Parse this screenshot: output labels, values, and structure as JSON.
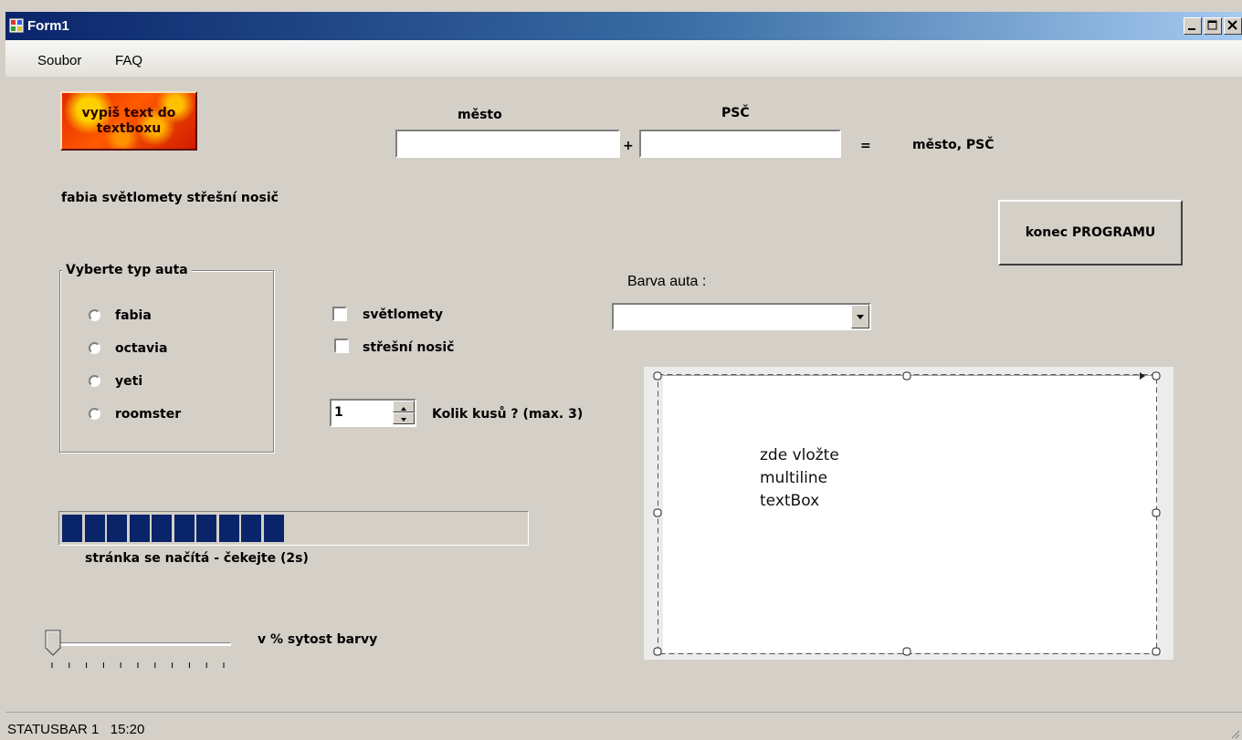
{
  "window": {
    "title": "Form1"
  },
  "menu": {
    "items": [
      "Soubor",
      "FAQ"
    ]
  },
  "fire_button": {
    "label_line1": "vypiš text do",
    "label_line2": "textboxu"
  },
  "address": {
    "city_label": "město",
    "zip_label": "PSČ",
    "city_value": "",
    "zip_value": "",
    "plus": "+",
    "equals": "=",
    "result": "město, PSČ"
  },
  "selection_summary": "fabia světlomety střešní nosič",
  "exit_button": {
    "label": "konec PROGRAMU"
  },
  "car_type_group": {
    "legend": "Vyberte typ auta",
    "options": [
      "fabia",
      "octavia",
      "yeti",
      "roomster"
    ]
  },
  "accessories": {
    "items": [
      "světlomety",
      "střešní nosič"
    ]
  },
  "color": {
    "label": "Barva auta :",
    "selected": ""
  },
  "quantity": {
    "value": "1",
    "label": "Kolik kusů ? (max. 3)"
  },
  "multiline": {
    "lines": [
      "zde vložte",
      "multiline",
      "textBox"
    ]
  },
  "progress": {
    "value_fraction": 0.48,
    "blocks_filled": 10,
    "label": "stránka se načítá - čekejte (2s)"
  },
  "saturation": {
    "label": "v % sytost barvy",
    "value": 0,
    "ticks": 11
  },
  "status": {
    "text": "STATUSBAR 1   15:20"
  },
  "colors": {
    "titlebar_start": "#0a246a",
    "titlebar_end": "#a6caf0",
    "form_bg": "#d4d0c8",
    "progress_fill": "#0a246a"
  }
}
